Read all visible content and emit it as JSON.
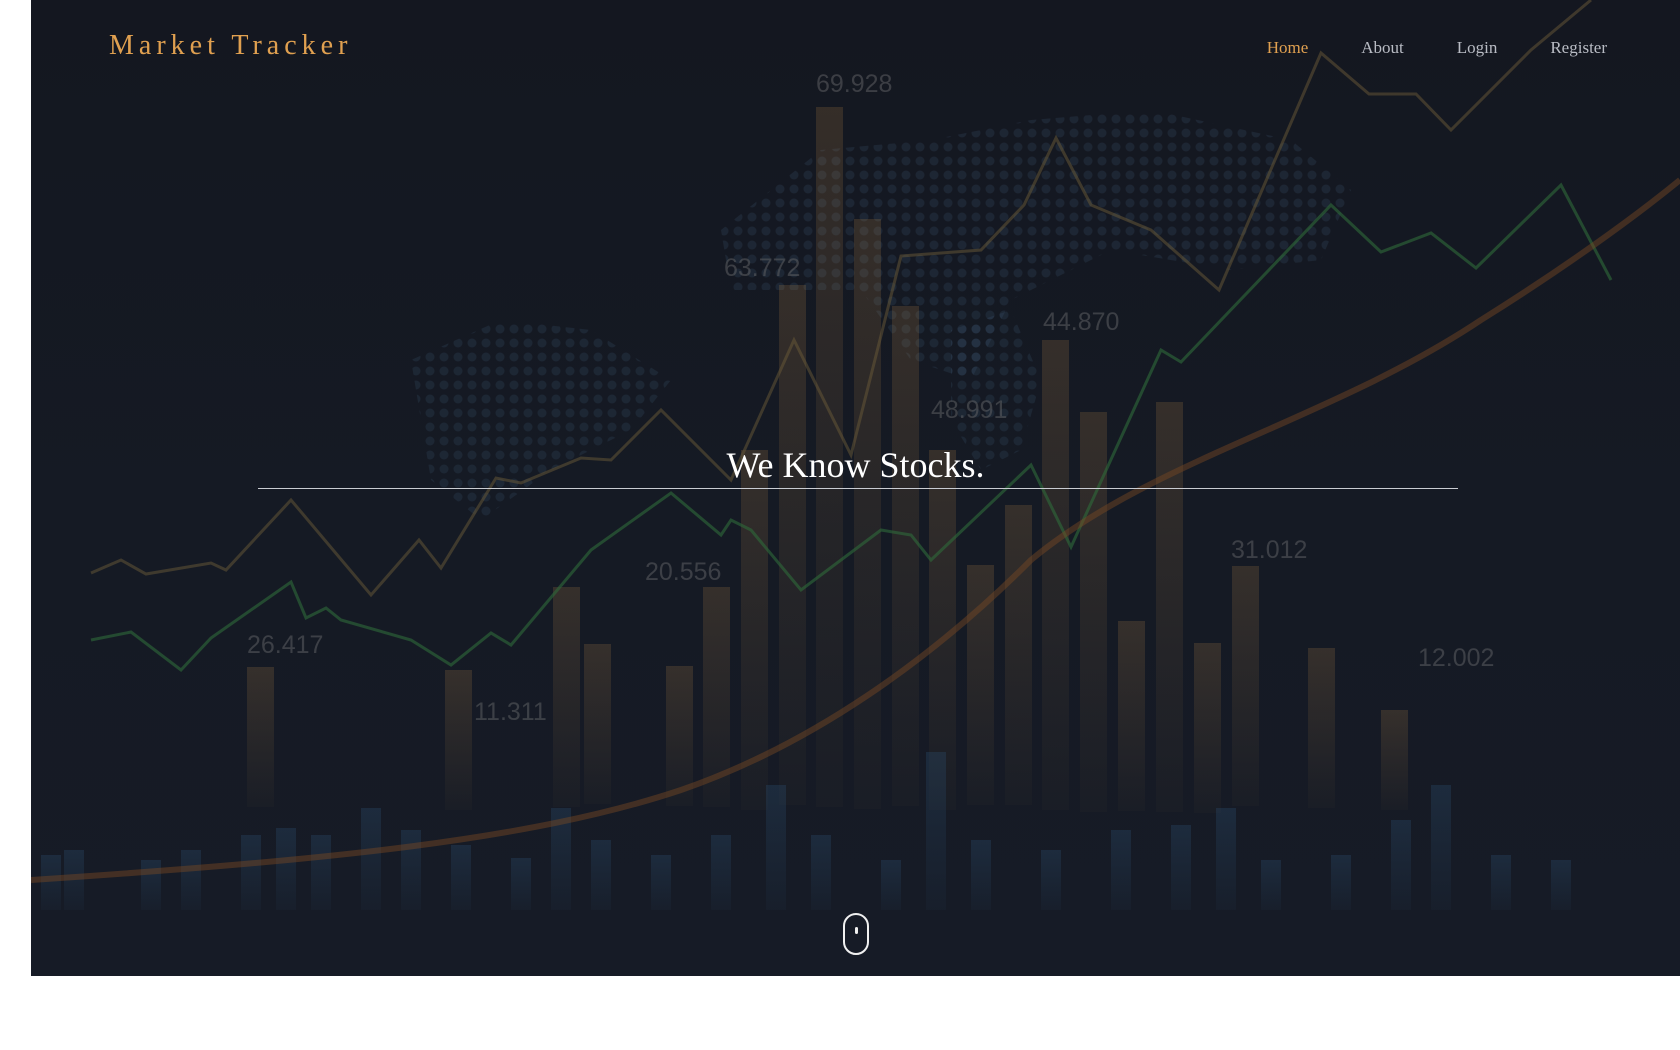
{
  "app": {
    "title": "Market Tracker"
  },
  "nav": {
    "items": [
      {
        "label": "Home",
        "active": true
      },
      {
        "label": "About",
        "active": false
      },
      {
        "label": "Login",
        "active": false
      },
      {
        "label": "Register",
        "active": false
      }
    ]
  },
  "hero": {
    "headline": "We Know Stocks.",
    "scroll_icon": "mouse-scroll-icon",
    "background_figures": [
      "69.928",
      "63.772",
      "44.870",
      "48.991",
      "26.417",
      "11.311",
      "20.556",
      "31.012",
      "12.002"
    ]
  },
  "colors": {
    "accent": "#e0a050",
    "background": "#151a24",
    "text": "#ffffff",
    "nav_text": "#b9bcc4"
  }
}
